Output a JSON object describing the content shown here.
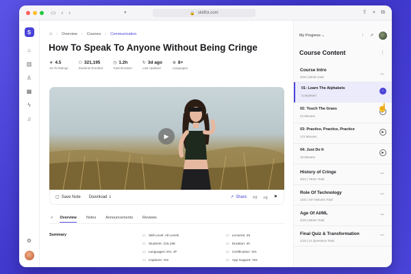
{
  "browser": {
    "url": "skillfor.com",
    "dot_colors": [
      "#ff5f57",
      "#febc2e",
      "#28c840"
    ]
  },
  "brand": {
    "accent": "#4a43d8",
    "logo_letter": "S"
  },
  "rail": {
    "icons": [
      "home-icon",
      "chart-icon",
      "user-icon",
      "calendar-icon",
      "bolt-icon",
      "bell-icon"
    ],
    "bottom_icons": [
      "settings-icon",
      "avatar"
    ]
  },
  "breadcrumb": {
    "items": [
      "Overview",
      "Courses",
      "Communication"
    ]
  },
  "course": {
    "title": "How To Speak To Anyone Without Being Cringe",
    "stats": [
      {
        "value": "4.5",
        "label": "16.7k Ratings",
        "icon": "star-icon"
      },
      {
        "value": "321,195",
        "label": "Students Enrolled",
        "icon": "users-icon"
      },
      {
        "value": "1.2h",
        "label": "Total Duration",
        "icon": "clock-icon"
      },
      {
        "value": "3d ago",
        "label": "Last Updated",
        "icon": "refresh-icon"
      },
      {
        "value": "8+",
        "label": "Languages",
        "icon": "globe-icon"
      }
    ]
  },
  "video_bar": {
    "save_note": "Save Note",
    "download": "Download",
    "share": "Share"
  },
  "tabs": [
    "Overview",
    "Notes",
    "Announcements",
    "Reviews"
  ],
  "active_tab": "Overview",
  "summary": {
    "label": "Summary",
    "col1": [
      "Skill Level: All Levels",
      "Students: 215,198",
      "Languages: EN, JP",
      "Captions: Yes"
    ],
    "col2": [
      "Lectures: 25",
      "Duration: 4h",
      "Certification: Yes",
      "App Support: Yes"
    ]
  },
  "panel": {
    "progress_label": "My Progress",
    "title": "Course Content",
    "sections": [
      {
        "title": "Course Intro",
        "sub": "2/18 | 60min total",
        "expanded": true
      },
      {
        "title": "History of Cringe",
        "sub": "3/22 | 75min Total"
      },
      {
        "title": "Role Of Technology",
        "sub": "1/15 | 167 Minutes Total"
      },
      {
        "title": "Age Of AI/ML",
        "sub": "2/18 | 60min Total"
      },
      {
        "title": "Final Quiz & Transformation",
        "sub": "1/10 | 12 Questions Total"
      }
    ],
    "lessons": [
      {
        "title": "01: Learn The Alphabets",
        "sub": "Completed",
        "state": "done"
      },
      {
        "title": "02: Touch The Grass",
        "sub": "23 Minutes",
        "state": "play"
      },
      {
        "title": "03: Practice, Practice, Practice",
        "sub": "172 Minutes",
        "state": "play"
      },
      {
        "title": "04: Just Do It",
        "sub": "19 Minutes",
        "state": "play"
      }
    ]
  }
}
